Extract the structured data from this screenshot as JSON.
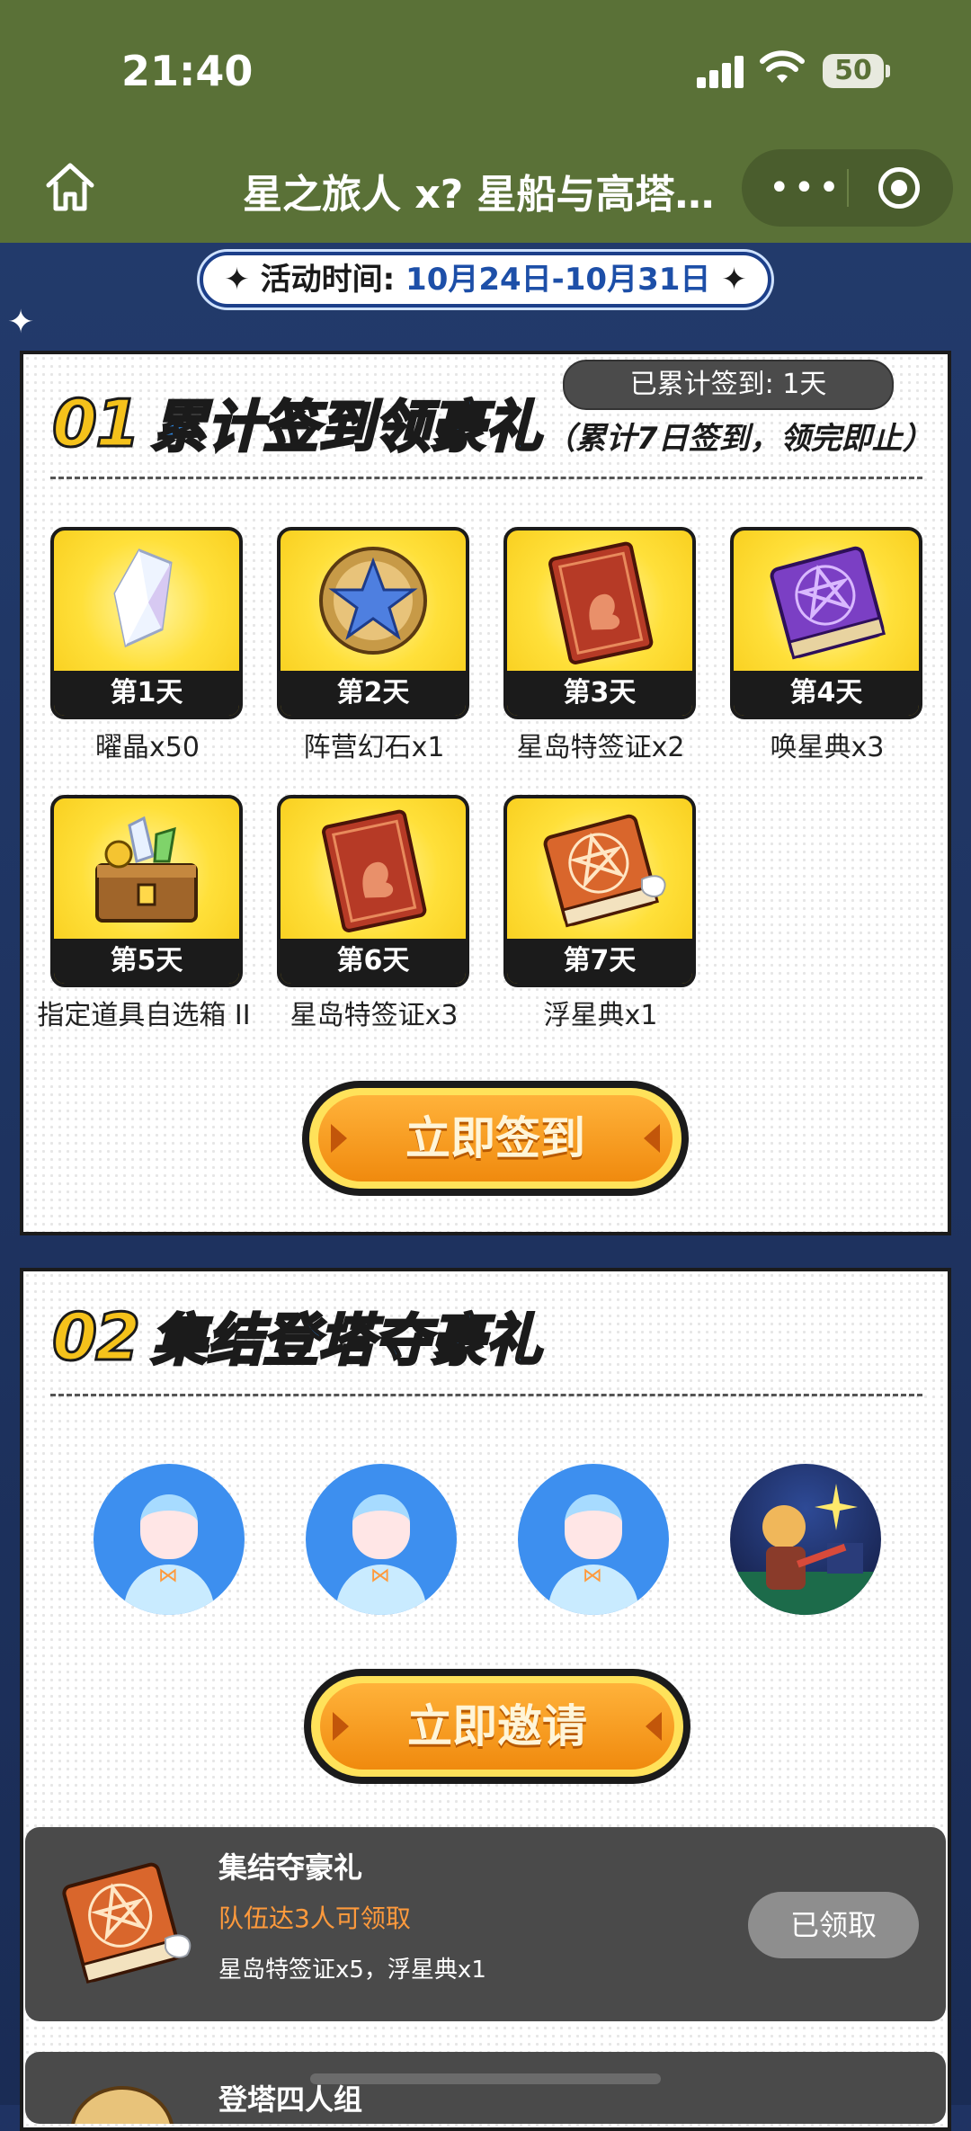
{
  "status_bar": {
    "time": "21:40",
    "battery": "50"
  },
  "nav": {
    "title": "星之旅人 x?  星船与高塔…"
  },
  "activity": {
    "label": "活动时间:",
    "dates": "10月24日-10月31日"
  },
  "section1": {
    "number": "01",
    "title": "累计签到领豪礼",
    "subtitle": "（累计7日签到，领完即止）",
    "signed_days": "已累计签到: 1天",
    "rewards": [
      {
        "day": "第1天",
        "name": "曜晶x50",
        "icon": "crystal-icon"
      },
      {
        "day": "第2天",
        "name": "阵营幻石x1",
        "icon": "star-emblem-icon"
      },
      {
        "day": "第3天",
        "name": "星岛特签证x2",
        "icon": "visa-card-icon"
      },
      {
        "day": "第4天",
        "name": "唤星典x3",
        "icon": "purple-book-icon"
      },
      {
        "day": "第5天",
        "name": "指定道具自选箱 II",
        "icon": "treasure-chest-icon"
      },
      {
        "day": "第6天",
        "name": "星岛特签证x3",
        "icon": "visa-card-icon"
      },
      {
        "day": "第7天",
        "name": "浮星典x1",
        "icon": "orange-book-icon"
      }
    ],
    "button": "立即签到"
  },
  "section2": {
    "number": "02",
    "title": "集结登塔夺豪礼",
    "button": "立即邀请",
    "tasks": [
      {
        "title": "集结夺豪礼",
        "condition": "队伍达3人可领取",
        "reward": "星岛特签证x5，浮星典x1",
        "button": "已领取"
      },
      {
        "title": "登塔四人组"
      }
    ]
  },
  "colors": {
    "nav_bg": "#5a7137",
    "accent_orange": "#f08a0e",
    "title_blue": "#2d8ae8",
    "task_bg": "#4a4a4a"
  }
}
